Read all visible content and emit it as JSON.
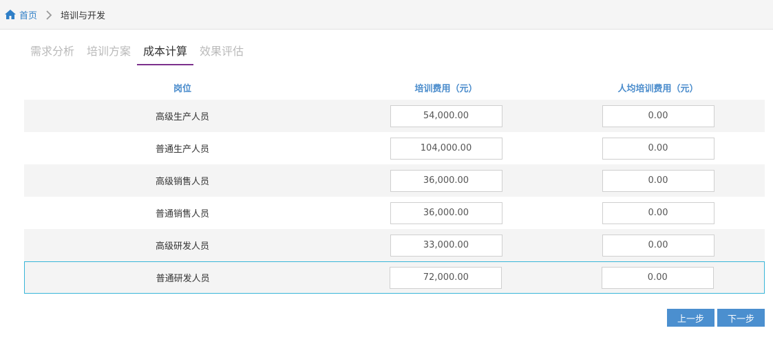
{
  "breadcrumb": {
    "home_icon": "home-icon",
    "home": "首页",
    "separator_icon": "chevron-right-icon",
    "current": "培训与开发"
  },
  "tabs": [
    {
      "label": "需求分析",
      "active": false
    },
    {
      "label": "培训方案",
      "active": false
    },
    {
      "label": "成本计算",
      "active": true
    },
    {
      "label": "效果评估",
      "active": false
    }
  ],
  "table": {
    "headers": [
      "岗位",
      "培训费用（元）",
      "人均培训费用（元）"
    ],
    "rows": [
      {
        "position": "高级生产人员",
        "cost": "54,000.00",
        "per_capita": "0.00"
      },
      {
        "position": "普通生产人员",
        "cost": "104,000.00",
        "per_capita": "0.00"
      },
      {
        "position": "高级销售人员",
        "cost": "36,000.00",
        "per_capita": "0.00"
      },
      {
        "position": "普通销售人员",
        "cost": "36,000.00",
        "per_capita": "0.00"
      },
      {
        "position": "高级研发人员",
        "cost": "33,000.00",
        "per_capita": "0.00"
      },
      {
        "position": "普通研发人员",
        "cost": "72,000.00",
        "per_capita": "0.00"
      }
    ]
  },
  "buttons": {
    "prev": "上一步",
    "next": "下一步"
  },
  "colors": {
    "accent": "#4b8fcf",
    "header_text": "#4a8ccc",
    "active_tab_underline": "#7b2f8c",
    "selected_row_border": "#36b5d8"
  }
}
